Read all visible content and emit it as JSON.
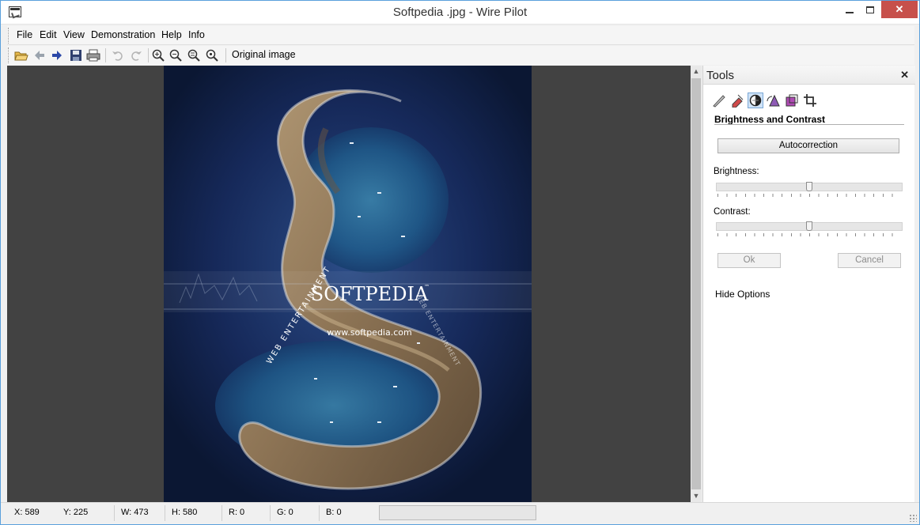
{
  "window": {
    "title": "Softpedia .jpg - Wire Pilot"
  },
  "menu": [
    "File",
    "Edit",
    "View",
    "Demonstration",
    "Help",
    "Info"
  ],
  "toolbar": {
    "original_image_label": "Original image"
  },
  "image": {
    "watermark_title": "SOFTPEDIA",
    "watermark_tm": "™",
    "watermark_url": "www.softpedia.com",
    "watermark_arc_left": "WEB ENTERTAINMENT",
    "watermark_arc_right": "WEB ENTERTAINMENT"
  },
  "tools_panel": {
    "title": "Tools",
    "section_title": "Brightness and Contrast",
    "autocorrection_label": "Autocorrection",
    "brightness_label": "Brightness:",
    "brightness_value": 0.5,
    "contrast_label": "Contrast:",
    "contrast_value": 0.5,
    "ok_label": "Ok",
    "cancel_label": "Cancel",
    "hide_options_label": "Hide Options"
  },
  "status": {
    "x": "X: 589",
    "y": "Y: 225",
    "w": "W: 473",
    "h": "H: 580",
    "r": "R: 0",
    "g": "G: 0",
    "b": "B: 0"
  },
  "colors": {
    "accent": "#5aa0dc",
    "close_button": "#c7504b",
    "canvas_bg": "#424242"
  }
}
